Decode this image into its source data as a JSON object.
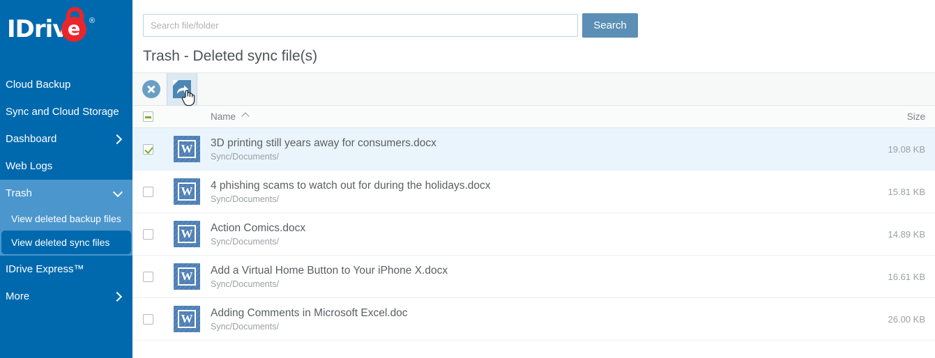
{
  "brand": {
    "name": "IDriv",
    "logo_letter": "e",
    "registered_mark": "®",
    "logo_icon": "padlock-icon",
    "primary_color": "#0069ad",
    "accent_red": "#e8262c"
  },
  "sidebar": {
    "items": [
      {
        "label": "Cloud Backup",
        "chevron": "none",
        "state": "normal"
      },
      {
        "label": "Sync and Cloud Storage",
        "chevron": "none",
        "state": "normal"
      },
      {
        "label": "Dashboard",
        "chevron": "right",
        "state": "normal"
      },
      {
        "label": "Web Logs",
        "chevron": "none",
        "state": "normal"
      },
      {
        "label": "Trash",
        "chevron": "down",
        "state": "expanded"
      },
      {
        "label": "IDrive Express™",
        "chevron": "none",
        "state": "normal"
      },
      {
        "label": "More",
        "chevron": "right",
        "state": "normal"
      }
    ],
    "trash_subitems": [
      {
        "label": "View deleted backup files",
        "active": false
      },
      {
        "label": "View deleted sync files",
        "active": true
      }
    ]
  },
  "search": {
    "placeholder": "Search file/folder",
    "value": "",
    "button_label": "Search"
  },
  "page": {
    "title": "Trash - Deleted sync file(s)"
  },
  "toolbar": {
    "buttons": [
      {
        "name": "delete-permanently-button",
        "icon": "close-circle-icon",
        "hovered": false
      },
      {
        "name": "restore-button",
        "icon": "restore-arrow-icon",
        "hovered": true
      }
    ]
  },
  "table": {
    "headers": {
      "select_all": {
        "icon": "indeterminate-checkbox-icon",
        "state": "indeterminate"
      },
      "name": "Name",
      "sort_direction": "ascending",
      "size": "Size"
    },
    "rows": [
      {
        "checked": true,
        "selected": true,
        "file_icon": "word-document-icon",
        "icon_letter": "W",
        "name": "3D printing still years away for consumers.docx",
        "path": "Sync/Documents/",
        "size": "19.08 KB"
      },
      {
        "checked": false,
        "selected": false,
        "file_icon": "word-document-icon",
        "icon_letter": "W",
        "name": "4 phishing scams to watch out for during the holidays.docx",
        "path": "Sync/Documents/",
        "size": "15.81 KB"
      },
      {
        "checked": false,
        "selected": false,
        "file_icon": "word-document-icon",
        "icon_letter": "W",
        "name": "Action Comics.docx",
        "path": "Sync/Documents/",
        "size": "14.89 KB"
      },
      {
        "checked": false,
        "selected": false,
        "file_icon": "word-document-icon",
        "icon_letter": "W",
        "name": "Add a Virtual Home Button to Your iPhone X.docx",
        "path": "Sync/Documents/",
        "size": "16.61 KB"
      },
      {
        "checked": false,
        "selected": false,
        "file_icon": "word-document-icon",
        "icon_letter": "W",
        "name": "Adding Comments in Microsoft Excel.doc",
        "path": "Sync/Documents/",
        "size": "26.00 KB"
      }
    ]
  }
}
